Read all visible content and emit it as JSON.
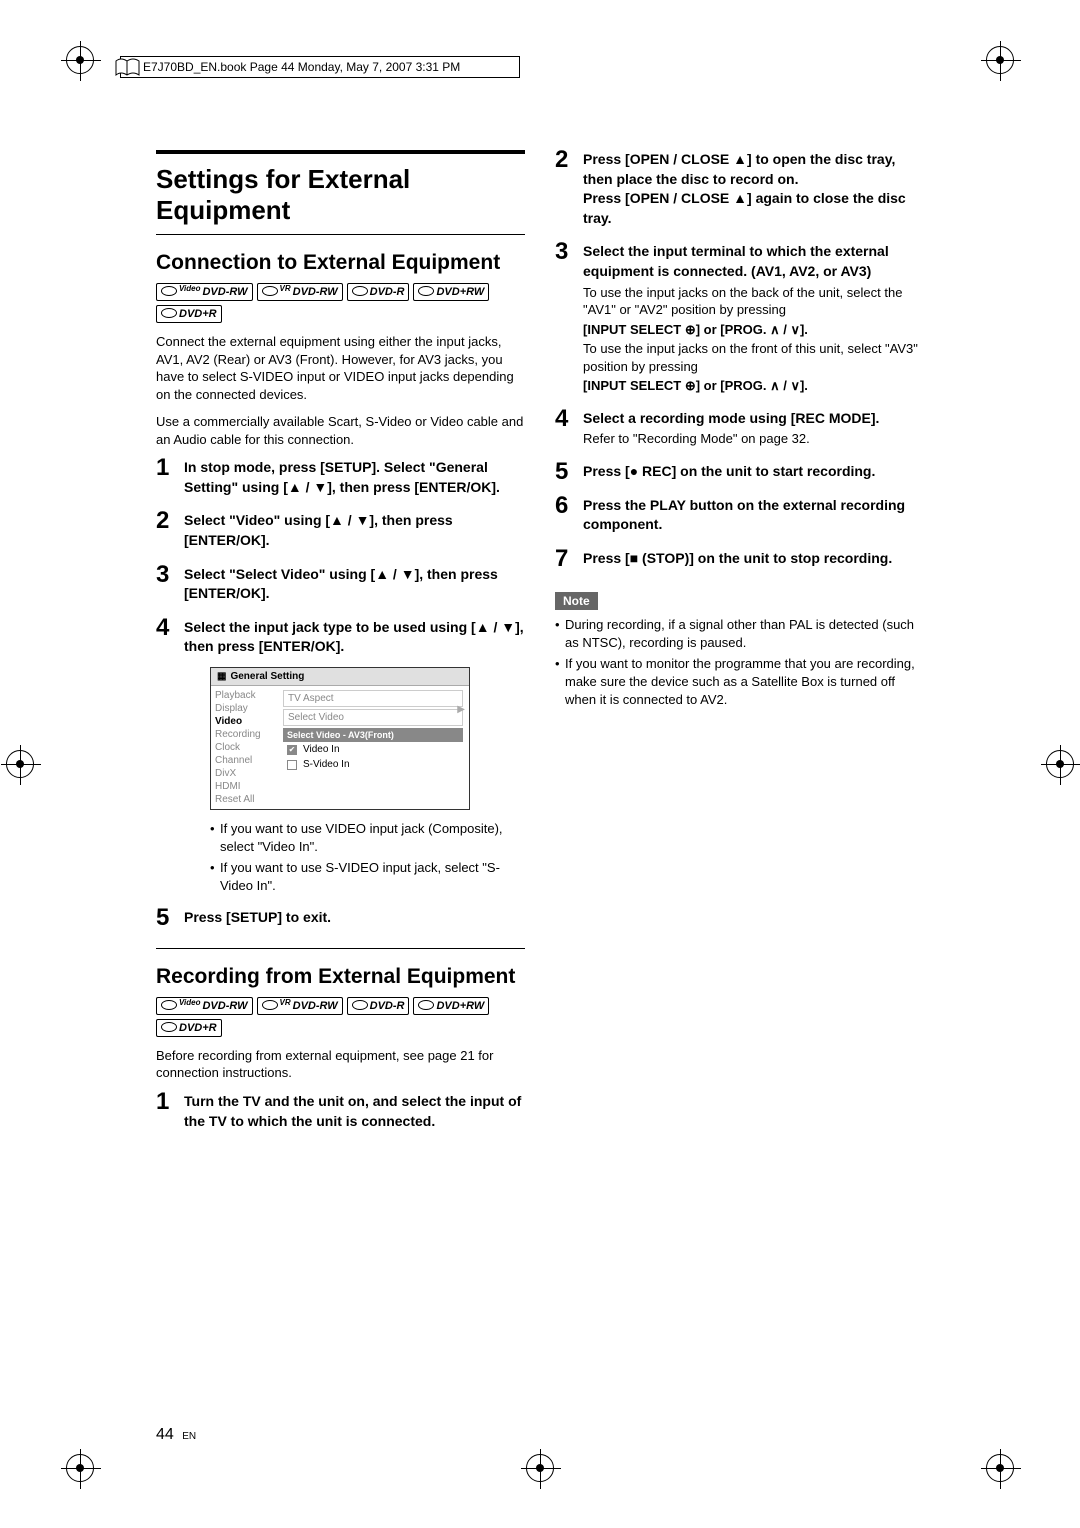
{
  "header": "E7J70BD_EN.book  Page 44  Monday, May 7, 2007  3:31 PM",
  "h1": "Settings for External Equipment",
  "h2a": "Connection to External Equipment",
  "h2b": "Recording from External Equipment",
  "badges": {
    "b1": {
      "sup": "Video",
      "label": "DVD-RW"
    },
    "b2": {
      "sup": "VR",
      "label": "DVD-RW"
    },
    "b3": {
      "sup": "",
      "label": "DVD-R"
    },
    "b4": {
      "sup": "",
      "label": "DVD+RW"
    },
    "b5": {
      "sup": "",
      "label": "DVD+R"
    }
  },
  "intro1": "Connect the external equipment using either the input jacks, AV1, AV2 (Rear) or AV3 (Front). However, for AV3 jacks, you have to select S-VIDEO input or VIDEO input jacks depending on the connected devices.",
  "intro2": "Use a commercially available Scart, S-Video or Video cable and an Audio cable for this connection.",
  "left_steps": {
    "s1": "In stop mode, press [SETUP]. Select \"General Setting\" using [▲ / ▼], then press [ENTER/OK].",
    "s2": "Select \"Video\" using [▲ / ▼], then press [ENTER/OK].",
    "s3": "Select \"Select Video\" using [▲ / ▼], then press [ENTER/OK].",
    "s4": "Select the input jack type to be used using [▲ / ▼], then press [ENTER/OK].",
    "s5": "Press [SETUP] to exit."
  },
  "ui": {
    "title": "General Setting",
    "sidebar": [
      "Playback",
      "Display",
      "Video",
      "Recording",
      "Clock",
      "Channel",
      "DivX",
      "HDMI",
      "Reset All"
    ],
    "row1a": "TV Aspect",
    "row1b": "Select Video",
    "dropdown": "Select Video - AV3(Front)",
    "opt1": "Video In",
    "opt2": "S-Video In"
  },
  "left_bullets": {
    "b1": "If you want to use VIDEO input jack (Composite), select \"Video In\".",
    "b2": "If you want to use S-VIDEO input jack, select \"S-Video In\"."
  },
  "rec_intro": "Before recording from external equipment, see page 21 for connection instructions.",
  "rec_steps": {
    "s1": "Turn the TV and the unit on, and select the input of the TV to which the unit is connected.",
    "s2": "Press [OPEN / CLOSE ▲] to open the disc tray, then place the disc to record on.\nPress [OPEN / CLOSE ▲] again to close the disc tray.",
    "s3": "Select the input terminal to which the external equipment is connected. (AV1, AV2, or AV3)",
    "s3_body1": "To use the input jacks on the back of the unit, select the \"AV1\" or \"AV2\" position by pressing",
    "s3_body2": "[INPUT SELECT ⊕] or [PROG. ∧ / ∨].",
    "s3_body3": "To use the input jacks on the front of this unit, select \"AV3\" position by pressing",
    "s3_body4": "[INPUT SELECT ⊕] or [PROG. ∧ / ∨].",
    "s4": "Select a recording mode using [REC MODE].",
    "s4_body": "Refer to \"Recording Mode\" on page 32.",
    "s5": "Press [● REC] on the unit to start recording.",
    "s6": "Press the PLAY button on the external recording component.",
    "s7": "Press [■ (STOP)] on the unit to stop recording."
  },
  "note_label": "Note",
  "note_bullets": {
    "b1": "During recording, if a signal other than PAL is detected (such as NTSC), recording is paused.",
    "b2": "If you want to monitor the programme that you are recording, make sure the device such as a Satellite Box is turned off when it is connected to AV2."
  },
  "page_number": "44",
  "page_lang": "EN"
}
